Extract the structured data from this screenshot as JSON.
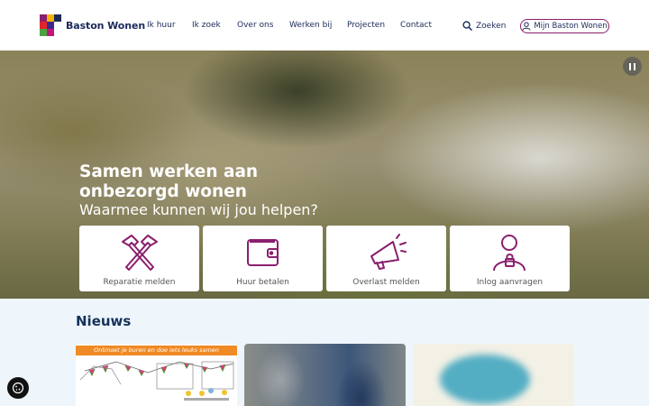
{
  "header": {
    "brand": "Baston Wonen",
    "nav": [
      "Ik huur",
      "Ik zoek",
      "Over ons",
      "Werken bij",
      "Projecten",
      "Contact"
    ],
    "search_label": "Zoeken",
    "account_label": "Mijn Baston Wonen"
  },
  "hero": {
    "title": "Samen werken aan onbezorgd wonen",
    "subtitle": "Waarmee kunnen wij jou helpen?",
    "tiles": [
      {
        "label": "Reparatie melden",
        "icon": "hammers-icon"
      },
      {
        "label": "Huur betalen",
        "icon": "wallet-icon"
      },
      {
        "label": "Overlast melden",
        "icon": "megaphone-icon"
      },
      {
        "label": "Inlog aanvragen",
        "icon": "user-lock-icon"
      }
    ]
  },
  "news": {
    "title": "Nieuws",
    "cards": [
      {
        "banner": "Ontmoet je buren en doe iets leuks samen"
      }
    ]
  },
  "colors": {
    "accent": "#8a1f6e",
    "navy": "#1b2a5a",
    "news_bg": "#eef6fc",
    "banner_orange": "#f08a24"
  }
}
